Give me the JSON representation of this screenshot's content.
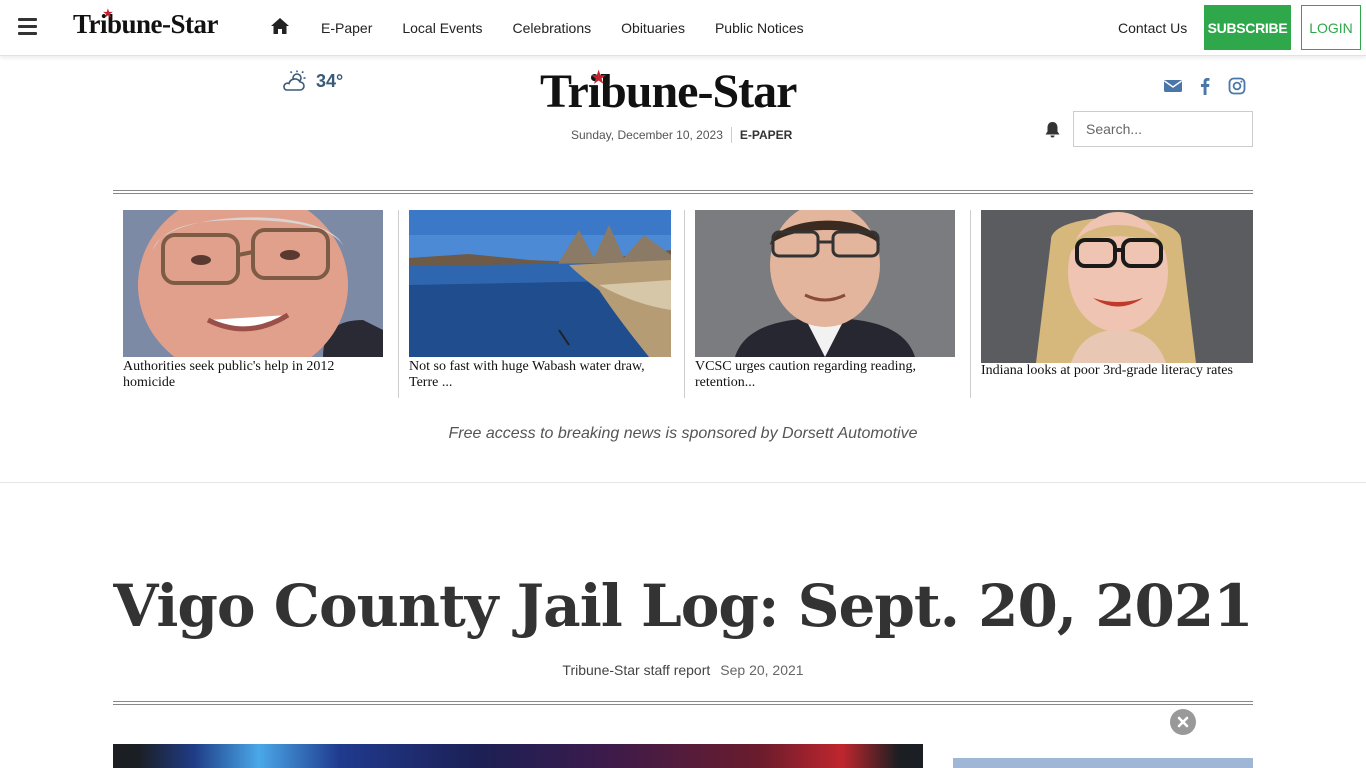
{
  "nav": {
    "logo": "Tribune-Star",
    "links": [
      "E-Paper",
      "Local Events",
      "Celebrations",
      "Obituaries",
      "Public Notices"
    ],
    "contact": "Contact Us",
    "subscribe": "SUBSCRIBE",
    "login": "LOGIN"
  },
  "header": {
    "temperature": "34°",
    "logo": "Tribune-Star",
    "date": "Sunday, December 10, 2023",
    "epaper": "E-PAPER",
    "search_placeholder": "Search..."
  },
  "features": [
    {
      "caption": "Authorities seek public's help in 2012 homicide"
    },
    {
      "caption": "Not so fast with huge Wabash water draw, Terre ..."
    },
    {
      "caption": "VCSC urges caution regarding reading, retention..."
    },
    {
      "caption": "Indiana looks at poor 3rd-grade literacy rates"
    }
  ],
  "sponsor_text": "Free access to breaking news is sponsored by Dorsett Automotive",
  "article": {
    "headline": "Vigo County Jail Log: Sept. 20, 2021",
    "author": "Tribune-Star staff report",
    "date": "Sep 20, 2021"
  },
  "colors": {
    "accent_green": "#2ea84a",
    "logo_star_red": "#c8202f",
    "icon_blue": "#4a76a8"
  },
  "icons": [
    "menu-icon",
    "home-icon",
    "weather-partly-cloudy-icon",
    "email-icon",
    "facebook-icon",
    "instagram-icon",
    "bell-icon",
    "close-icon"
  ]
}
